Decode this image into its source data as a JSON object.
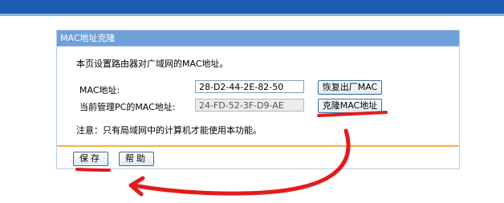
{
  "panel": {
    "title": "MAC地址克隆",
    "description": "本页设置路由器对广域网的MAC地址。",
    "mac_label": "MAC地址:",
    "mac_value": "28-D2-44-2E-82-50",
    "pc_mac_label": "当前管理PC的MAC地址:",
    "pc_mac_value": "24-FD-52-3F-D9-AE",
    "restore_button": "恢复出厂MAC",
    "clone_button": "克隆MAC地址",
    "note": "注意：只有局域网中的计算机才能使用本功能。",
    "save_button": "保存",
    "help_button": "帮助"
  },
  "colors": {
    "header_bar": "#1c5db0",
    "panel_title_bg": "#6fa0d8",
    "separator": "#f7b04a",
    "annotation": "#e41b1b"
  },
  "annotation": {
    "type": "red hand-drawn arrow",
    "from": "clone-mac-button",
    "to": "save-button"
  }
}
